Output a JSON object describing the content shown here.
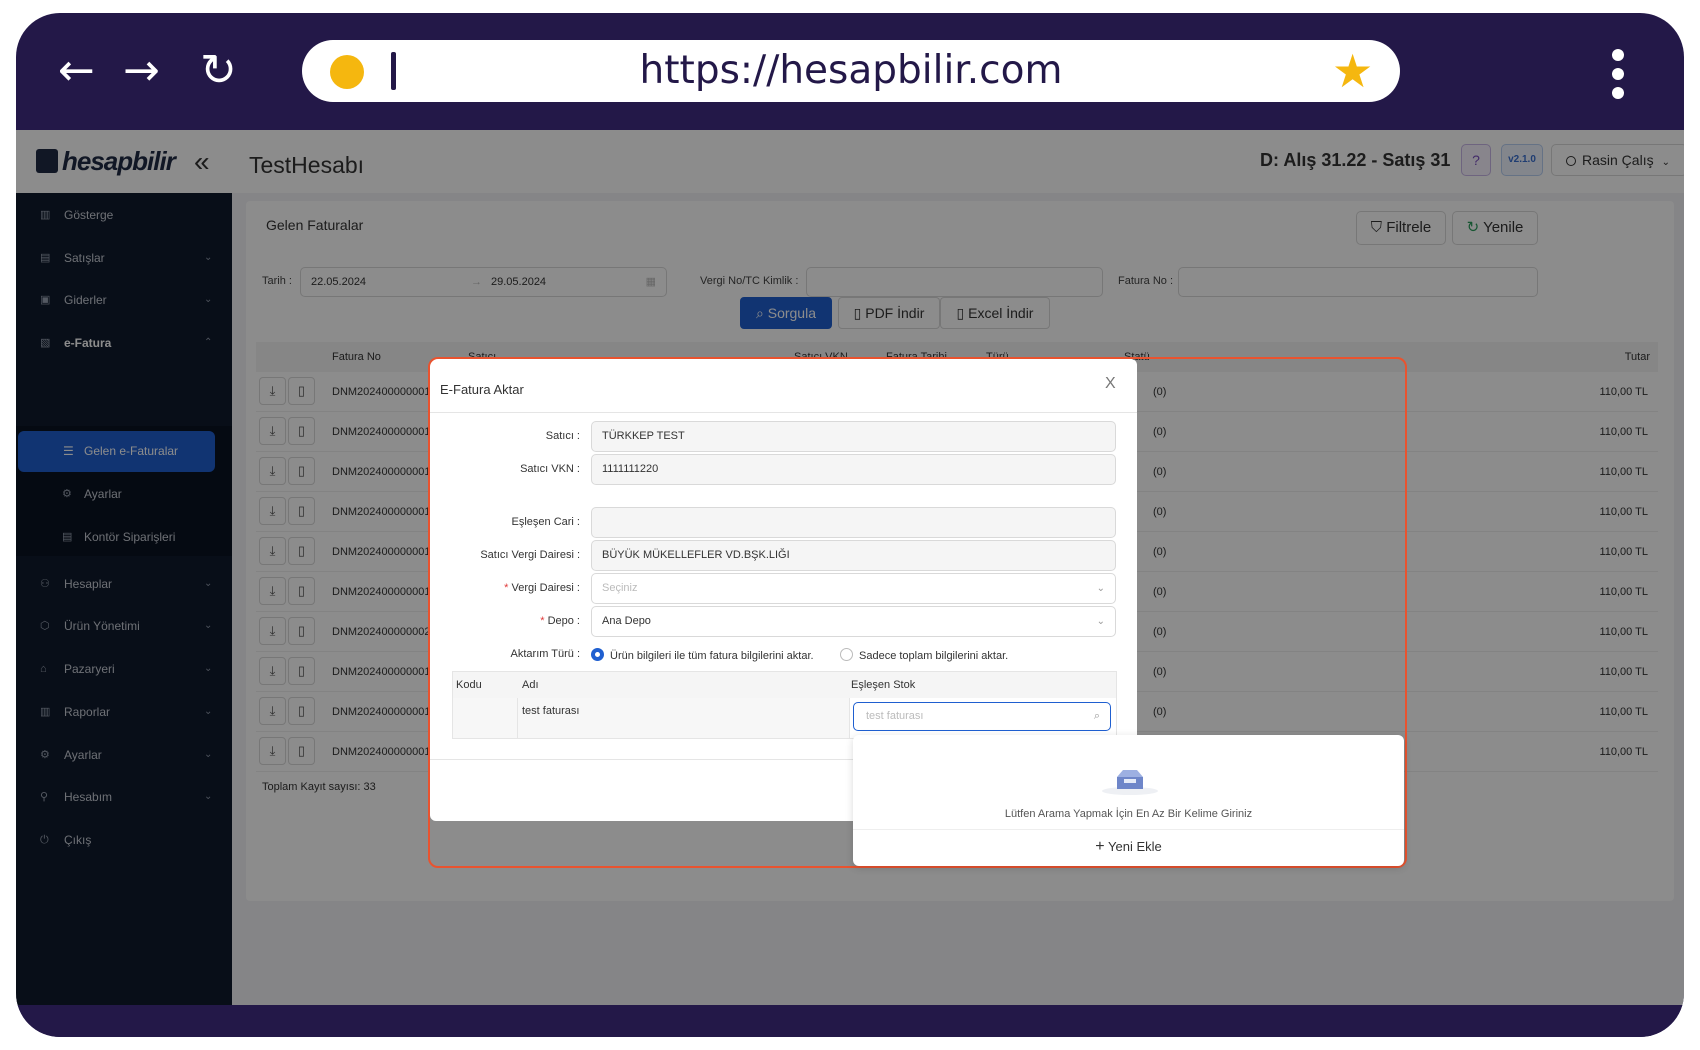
{
  "browser": {
    "url": "https://hesapbilir.com",
    "back_icon": "←",
    "forward_icon": "→",
    "reload_icon": "↻",
    "star_icon": "★"
  },
  "topbar": {
    "logo": "hesapbilir",
    "collapse_icon": "«",
    "account": "TestHesabı",
    "ticker": "D: Alış 31.22 - Satış 31.2",
    "help": "?",
    "version": "v2.1.0",
    "user": "Rasin Çalış"
  },
  "sidebar": {
    "items": [
      {
        "label": "Gösterge"
      },
      {
        "label": "Satışlar"
      },
      {
        "label": "Giderler"
      },
      {
        "label": "e-Fatura"
      },
      {
        "label": "Gelen e-Faturalar"
      },
      {
        "label": "Ayarlar"
      },
      {
        "label": "Kontör Siparişleri"
      },
      {
        "label": "Hesaplar"
      },
      {
        "label": "Ürün Yönetimi"
      },
      {
        "label": "Pazaryeri"
      },
      {
        "label": "Raporlar"
      },
      {
        "label": "Ayarlar"
      },
      {
        "label": "Hesabım"
      },
      {
        "label": "Çıkış"
      }
    ]
  },
  "page": {
    "title": "Gelen Faturalar",
    "filter_btn": "Filtrele",
    "refresh_btn": "Yenile",
    "date_label": "Tarih :",
    "date_from": "22.05.2024",
    "date_sep": "→",
    "date_to": "29.05.2024",
    "tax_label": "Vergi No/TC Kimlik :",
    "invoice_label": "Fatura No :",
    "search_btn": "Sorgula",
    "pdf_btn": "PDF İndir",
    "excel_btn": "Excel İndir",
    "columns": [
      "Fatura No",
      "Satıcı",
      "Satıcı VKN",
      "Fatura Tarihi",
      "Türü",
      "Statü",
      "Tutar"
    ],
    "rows": [
      {
        "no": "DNM2024000000016",
        "status": "(0)",
        "amount": "110,00 TL"
      },
      {
        "no": "DNM2024000000015",
        "status": "(0)",
        "amount": "110,00 TL"
      },
      {
        "no": "DNM2024000000014",
        "status": "(0)",
        "amount": "110,00 TL"
      },
      {
        "no": "DNM2024000000013",
        "status": "(0)",
        "amount": "110,00 TL"
      },
      {
        "no": "DNM2024000000012",
        "status": "(0)",
        "amount": "110,00 TL"
      },
      {
        "no": "DNM2024000000011",
        "status": "(0)",
        "amount": "110,00 TL"
      },
      {
        "no": "DNM2024000000020",
        "status": "(0)",
        "amount": "110,00 TL"
      },
      {
        "no": "DNM2024000000019",
        "status": "(0)",
        "amount": "110,00 TL"
      },
      {
        "no": "DNM2024000000018",
        "status": "(0)",
        "amount": "110,00 TL"
      },
      {
        "no": "DNM2024000000017",
        "status": "",
        "amount": "110,00 TL"
      }
    ],
    "total": "Toplam Kayıt sayısı: 33"
  },
  "modal": {
    "title": "E-Fatura Aktar",
    "close": "X",
    "seller_label": "Satıcı :",
    "seller": "TÜRKKEP TEST",
    "vkn_label": "Satıcı VKN :",
    "vkn": "1111111220",
    "cari_label": "Eşleşen Cari :",
    "cari": "",
    "seller_tax_office_label": "Satıcı Vergi Dairesi :",
    "seller_tax_office": "BÜYÜK MÜKELLEFLER VD.BŞK.LIĞI",
    "tax_office_label": "Vergi Dairesi :",
    "tax_office_placeholder": "Seçiniz",
    "depot_label": "Depo :",
    "depot": "Ana Depo",
    "transfer_label": "Aktarım Türü :",
    "transfer_opt1": "Ürün bilgileri ile tüm fatura bilgilerini aktar.",
    "transfer_opt2": "Sadece toplam bilgilerini aktar.",
    "cols": [
      "Kodu",
      "Adı",
      "Eşleşen Stok"
    ],
    "item_name": "test faturası",
    "stock_placeholder": "test faturası"
  },
  "dropdown": {
    "empty_text": "Lütfen Arama Yapmak İçin En Az Bir Kelime Giriniz",
    "add_new": "Yeni Ekle"
  },
  "colors": {
    "frame": "#231848",
    "primary": "#1f5fd0",
    "highlight": "#e9532f",
    "sidebar": "#0f1a2d"
  }
}
